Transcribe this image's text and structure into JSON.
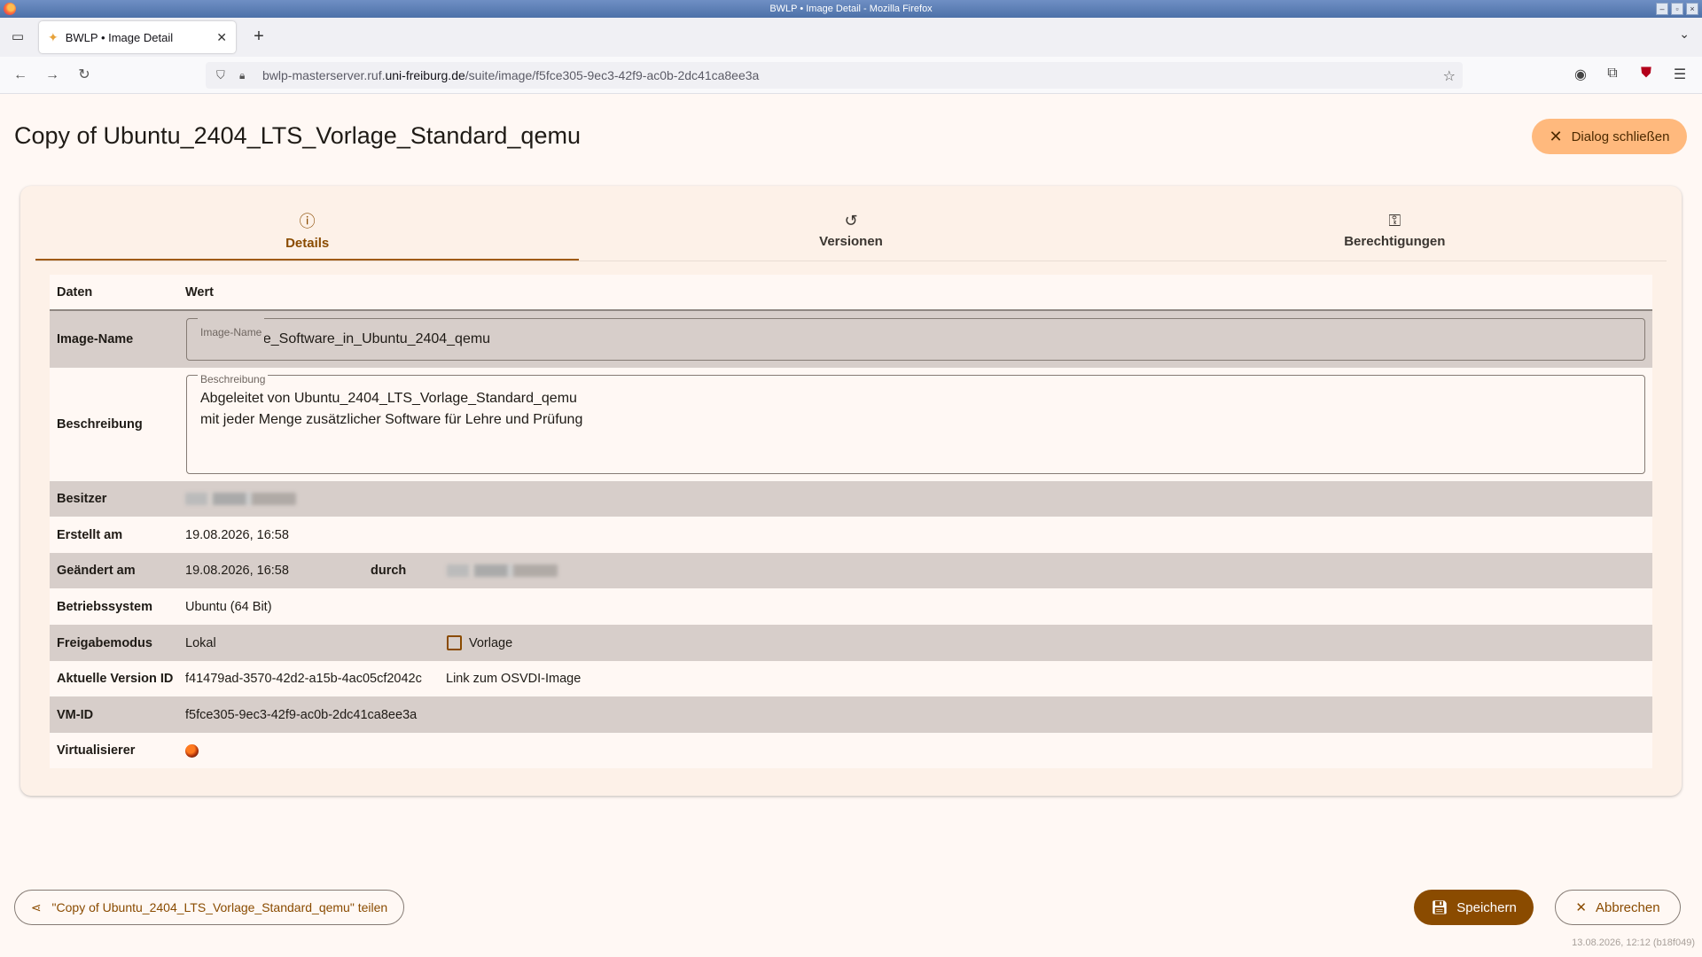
{
  "window": {
    "title": "BWLP • Image Detail - Mozilla Firefox"
  },
  "browser": {
    "tab_title": "BWLP • Image Detail",
    "url_prefix": "bwlp-masterserver.ruf.",
    "url_host": "uni-freiburg.de",
    "url_path": "/suite/image/f5fce305-9ec3-42f9-ac0b-2dc41ca8ee3a"
  },
  "page": {
    "title": "Copy of Ubuntu_2404_LTS_Vorlage_Standard_qemu",
    "close_dialog_label": "Dialog schließen"
  },
  "tabs": [
    {
      "label": "Details",
      "icon": "info-icon",
      "active": true
    },
    {
      "label": "Versionen",
      "icon": "history-icon",
      "active": false
    },
    {
      "label": "Berechtigungen",
      "icon": "key-icon",
      "active": false
    }
  ],
  "table": {
    "header_data": "Daten",
    "header_value": "Wert",
    "image_name": {
      "label": "Image-Name",
      "legend": "Image-Name",
      "value": "Viele_neue_Software_in_Ubuntu_2404_qemu"
    },
    "description": {
      "label": "Beschreibung",
      "legend": "Beschreibung",
      "line1": "Abgeleitet von Ubuntu_2404_LTS_Vorlage_Standard_qemu",
      "line2": "mit jeder Menge zusätzlicher Software für Lehre und Prüfung"
    },
    "owner": {
      "label": "Besitzer"
    },
    "created": {
      "label": "Erstellt am",
      "value": "19.08.2026, 16:58"
    },
    "changed": {
      "label": "Geändert am",
      "value": "19.08.2026, 16:58",
      "by_label": "durch"
    },
    "os": {
      "label": "Betriebssystem",
      "value": "Ubuntu (64 Bit)"
    },
    "share_mode": {
      "label": "Freigabemodus",
      "value": "Lokal",
      "template_label": "Vorlage",
      "template_checked": false
    },
    "current_version": {
      "label": "Aktuelle Version ID",
      "value": "f41479ad-3570-42d2-a15b-4ac05cf2042c",
      "link": "Link zum OSVDI-Image"
    },
    "vm_id": {
      "label": "VM-ID",
      "value": "f5fce305-9ec3-42f9-ac0b-2dc41ca8ee3a"
    },
    "virtualizer": {
      "label": "Virtualisierer",
      "icon": "qemu-icon"
    }
  },
  "footer": {
    "share_label": "\"Copy of Ubuntu_2404_LTS_Vorlage_Standard_qemu\" teilen",
    "save_label": "Speichern",
    "cancel_label": "Abbrechen",
    "build_info": "13.08.2026, 12:12 (b18f049)"
  },
  "colors": {
    "accent": "#8a4b00",
    "tonal_button": "#ffb97d",
    "row_alt": "#d7ceca",
    "background": "#fff8f4"
  }
}
